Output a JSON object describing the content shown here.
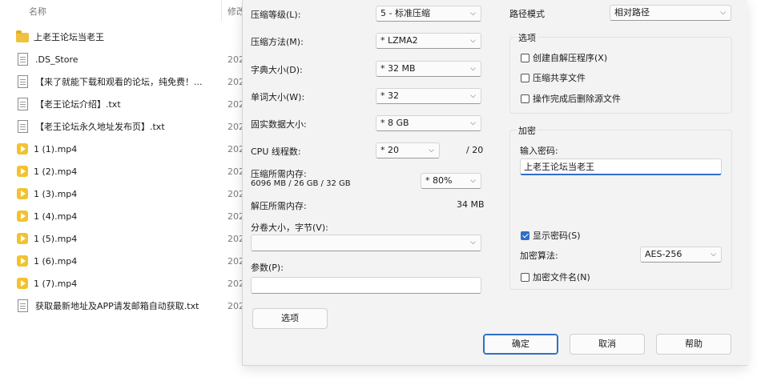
{
  "explorer": {
    "column_name": "名称",
    "column_date": "修改",
    "files": [
      {
        "name": "上老王论坛当老王",
        "type": "folder",
        "date": ""
      },
      {
        "name": ".DS_Store",
        "type": "doc",
        "date": "202"
      },
      {
        "name": "【来了就能下载和观看的论坛，纯免费！...",
        "type": "doc",
        "date": "202"
      },
      {
        "name": "【老王论坛介绍】.txt",
        "type": "doc",
        "date": "202"
      },
      {
        "name": "【老王论坛永久地址发布页】.txt",
        "type": "doc",
        "date": "202"
      },
      {
        "name": "1 (1).mp4",
        "type": "video",
        "date": "202"
      },
      {
        "name": "1 (2).mp4",
        "type": "video",
        "date": "202"
      },
      {
        "name": "1 (3).mp4",
        "type": "video",
        "date": "202"
      },
      {
        "name": "1 (4).mp4",
        "type": "video",
        "date": "202"
      },
      {
        "name": "1 (5).mp4",
        "type": "video",
        "date": "202"
      },
      {
        "name": "1 (6).mp4",
        "type": "video",
        "date": "202"
      },
      {
        "name": "1 (7).mp4",
        "type": "video",
        "date": "202"
      },
      {
        "name": "获取最新地址及APP请发邮箱自动获取.txt",
        "type": "doc",
        "date": "202"
      }
    ]
  },
  "dialog": {
    "compression_level": {
      "label": "压缩等级(L):",
      "value": "5 - 标准压缩"
    },
    "compression_method": {
      "label": "压缩方法(M):",
      "value": "* LZMA2"
    },
    "dictionary_size": {
      "label": "字典大小(D):",
      "value": "* 32 MB"
    },
    "word_size": {
      "label": "单词大小(W):",
      "value": "* 32"
    },
    "solid_block_size": {
      "label": "固实数据大小:",
      "value": "* 8 GB"
    },
    "cpu_threads": {
      "label": "CPU 线程数:",
      "value": "* 20",
      "max": "/ 20"
    },
    "compress_memory": {
      "label": "压缩所需内存:",
      "detail": "6096 MB / 26 GB / 32 GB",
      "value": "* 80%"
    },
    "decompress_memory": {
      "label": "解压所需内存:",
      "value": "34 MB"
    },
    "split_volumes": {
      "label": "分卷大小，字节(V):",
      "value": ""
    },
    "parameters": {
      "label": "参数(P):",
      "value": ""
    },
    "options_button": "选项",
    "path_mode": {
      "label": "路径模式",
      "value": "相对路径"
    },
    "options_group": {
      "title": "选项",
      "items": [
        {
          "label": "创建自解压程序(X)",
          "checked": false
        },
        {
          "label": "压缩共享文件",
          "checked": false
        },
        {
          "label": "操作完成后删除源文件",
          "checked": false
        }
      ]
    },
    "encryption_group": {
      "title": "加密",
      "password_label": "输入密码:",
      "password_value": "上老王论坛当老王",
      "show_password": {
        "label": "显示密码(S)",
        "checked": true
      },
      "method_label": "加密算法:",
      "method_value": "AES-256",
      "encrypt_names": {
        "label": "加密文件名(N)",
        "checked": false
      }
    },
    "ok_button": "确定",
    "cancel_button": "取消",
    "help_button": "帮助"
  },
  "colors": {
    "accent": "#2f6fc9",
    "dialog_bg": "#f3f3f3",
    "folder": "#f0c040",
    "video": "#f2c230"
  }
}
